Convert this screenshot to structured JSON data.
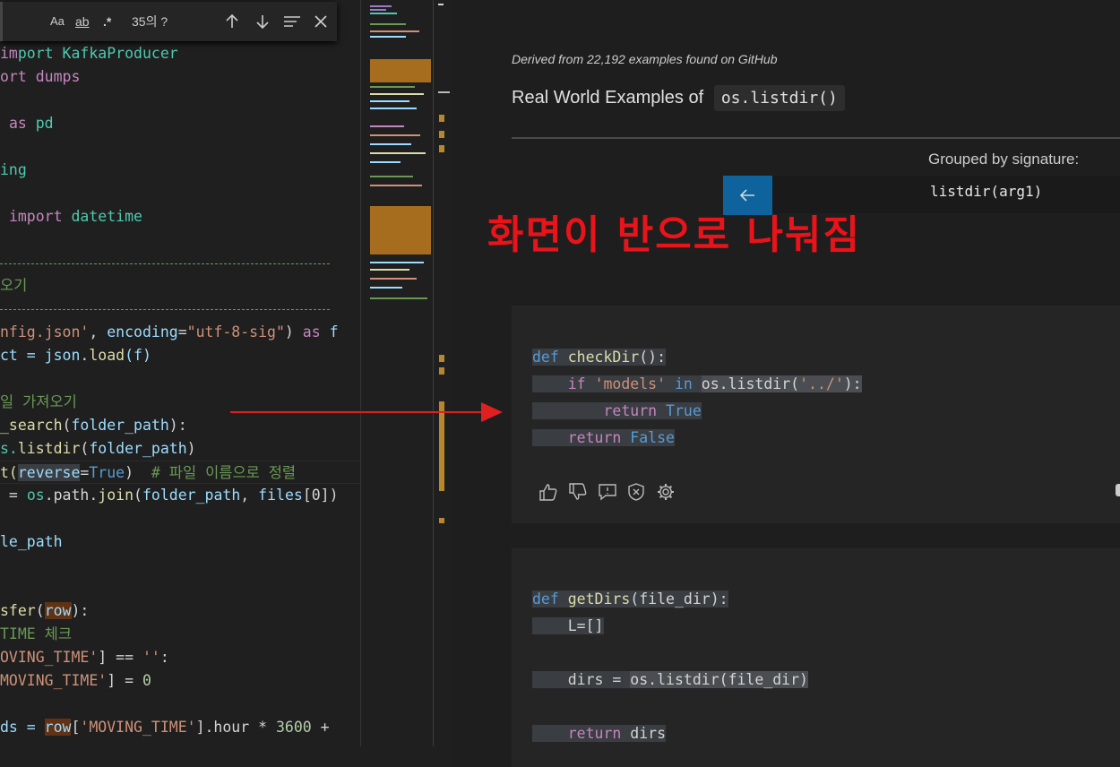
{
  "find_widget": {
    "query": "",
    "match_case": "Aa",
    "whole_word": "ab",
    "regex": ".*",
    "result_count": "35의 ?",
    "prev_icon": "arrow-up-icon",
    "next_icon": "arrow-down-icon",
    "selection_icon": "list-filter-icon",
    "close_icon": "close-icon"
  },
  "editor": {
    "l1": "port KafkaProducer",
    "l2": "ort dumps",
    "l3_kw": "as",
    "l3_name": "pd",
    "l4": "ing",
    "l5_kw": "import",
    "l5_name": "datetime",
    "l6": "오기",
    "l7a": "nfig.json'",
    "l7b": ", ",
    "l7c": "encoding",
    "l7d": "=",
    "l7e": "\"utf-8-sig\"",
    "l7f": ") ",
    "l7g": "as",
    "l7h": " f",
    "l8a": "ct = ",
    "l8b": "json",
    "l8c": ".",
    "l8d": "load",
    "l8e": "(f)",
    "l9": "일 가져오기",
    "l10a": "_search",
    "l10b": "(",
    "l10c": "folder_path",
    "l10d": "):",
    "l11a": "s.",
    "l11b": "listdir",
    "l11c": "(",
    "l11d": "folder_path",
    "l11e": ")",
    "l12a": "t(",
    "l12b": "reverse",
    "l12c": "=",
    "l12d": "True",
    "l12e": ")  ",
    "l12f": "# 파일 이름으로 정렬",
    "l13a": " = ",
    "l13b": "os",
    "l13c": ".path.",
    "l13d": "join",
    "l13e": "(",
    "l13f": "folder_path",
    "l13g": ", ",
    "l13h": "files",
    "l13i": "[0])",
    "l14": "le_path",
    "l15a": "sfer",
    "l15b": "(",
    "l15c": "row",
    "l15d": "):",
    "l16": "TIME 체크",
    "l17a": "OVING_TIME'",
    "l17b": "] == ",
    "l17c": "''",
    "l17d": ":",
    "l18a": "MOVING_TIME'",
    "l18b": "] = ",
    "l18c": "0",
    "l19a": "ds = ",
    "l19b": "row",
    "l19c": "[",
    "l19d": "'MOVING_TIME'",
    "l19e": "].hour * ",
    "l19f": "3600",
    "l19g": " +"
  },
  "panel": {
    "derived": "Derived from 22,192 examples found on GitHub",
    "title_prefix": "Real World Examples of",
    "title_code": "os.listdir()",
    "grouped_label": "Grouped by signature:",
    "signature": "listdir(arg1)",
    "back_icon": "arrow-left-icon",
    "annotation": "화면이 반으로 나눠짐",
    "example1": {
      "l1a": "def",
      "l1b": " ",
      "l1c": "checkDir",
      "l1d": "():",
      "l2a": "if",
      "l2b": " ",
      "l2c": "'models'",
      "l2d": " ",
      "l2e": "in",
      "l2f": " ",
      "l2g": "os.listdir(",
      "l2h": "'../'",
      "l2i": "):",
      "l3a": "return",
      "l3b": " ",
      "l3c": "True",
      "l4a": "return",
      "l4b": " ",
      "l4c": "False"
    },
    "feedback_icons": [
      "thumbs-up-icon",
      "thumbs-down-icon",
      "comment-icon",
      "shield-x-icon",
      "gear-icon"
    ],
    "example2": {
      "l1a": "def",
      "l1b": " ",
      "l1c": "getDirs",
      "l1d": "(file_dir):",
      "l2": "L=[]",
      "l3a": "dirs = ",
      "l3b": "os.listdir(file_dir)",
      "l4a": "return",
      "l4b": " dirs"
    }
  },
  "colors": {
    "annotation": "#e8141a",
    "arrow": "#e02020",
    "accent_button": "#0e639c"
  }
}
